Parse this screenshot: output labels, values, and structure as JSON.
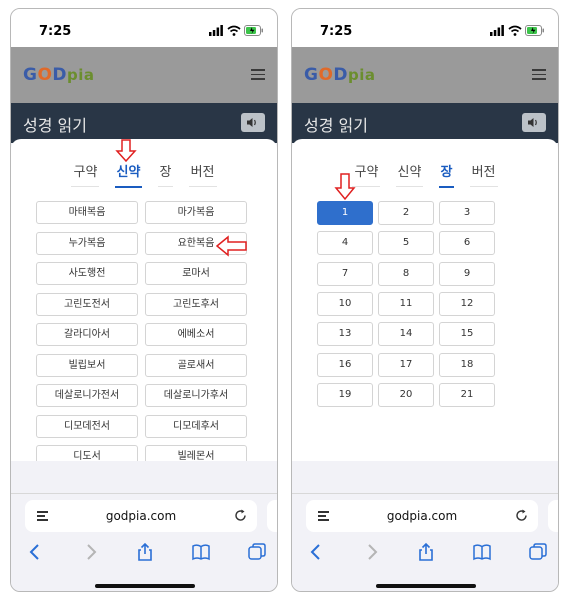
{
  "left": {
    "status": {
      "time": "7:25"
    },
    "header": {
      "logo": {
        "g": "G",
        "o": "O",
        "d": "D",
        "pia": "pia"
      }
    },
    "title": "성경 읽기",
    "tabs": [
      {
        "label": "구약",
        "active": false
      },
      {
        "label": "신약",
        "active": true
      },
      {
        "label": "장",
        "active": false
      },
      {
        "label": "버전",
        "active": false
      }
    ],
    "books": [
      "마태복음",
      "마가복음",
      "누가복음",
      "요한복음",
      "사도행전",
      "로마서",
      "고린도전서",
      "고린도후서",
      "갈라디아서",
      "에베소서",
      "빌립보서",
      "골로새서",
      "데살로니가전서",
      "데살로니가후서",
      "디모데전서",
      "디모데후서",
      "디도서",
      "빌레몬서"
    ],
    "browser": {
      "url": "godpia.com"
    }
  },
  "right": {
    "status": {
      "time": "7:25"
    },
    "header": {
      "logo": {
        "g": "G",
        "o": "O",
        "d": "D",
        "pia": "pia"
      }
    },
    "title": "성경 읽기",
    "tabs": [
      {
        "label": "구약",
        "active": false
      },
      {
        "label": "신약",
        "active": false
      },
      {
        "label": "장",
        "active": true
      },
      {
        "label": "버전",
        "active": false
      }
    ],
    "chapters": [
      "1",
      "2",
      "3",
      "4",
      "5",
      "6",
      "7",
      "8",
      "9",
      "10",
      "11",
      "12",
      "13",
      "14",
      "15",
      "16",
      "17",
      "18",
      "19",
      "20",
      "21"
    ],
    "selected_chapter": "1",
    "browser": {
      "url": "godpia.com"
    }
  },
  "colors": {
    "accent": "#1a5cc0",
    "selected_button": "#2f6fcc",
    "annotation_arrow": "#e02020",
    "title_bar": "#293646"
  },
  "icons": [
    "signal-icon",
    "wifi-icon",
    "battery-icon",
    "hamburger-menu-icon",
    "speaker-icon",
    "reader-icon",
    "reload-icon",
    "back-icon",
    "forward-icon",
    "share-icon",
    "bookmarks-icon",
    "tabs-icon"
  ]
}
